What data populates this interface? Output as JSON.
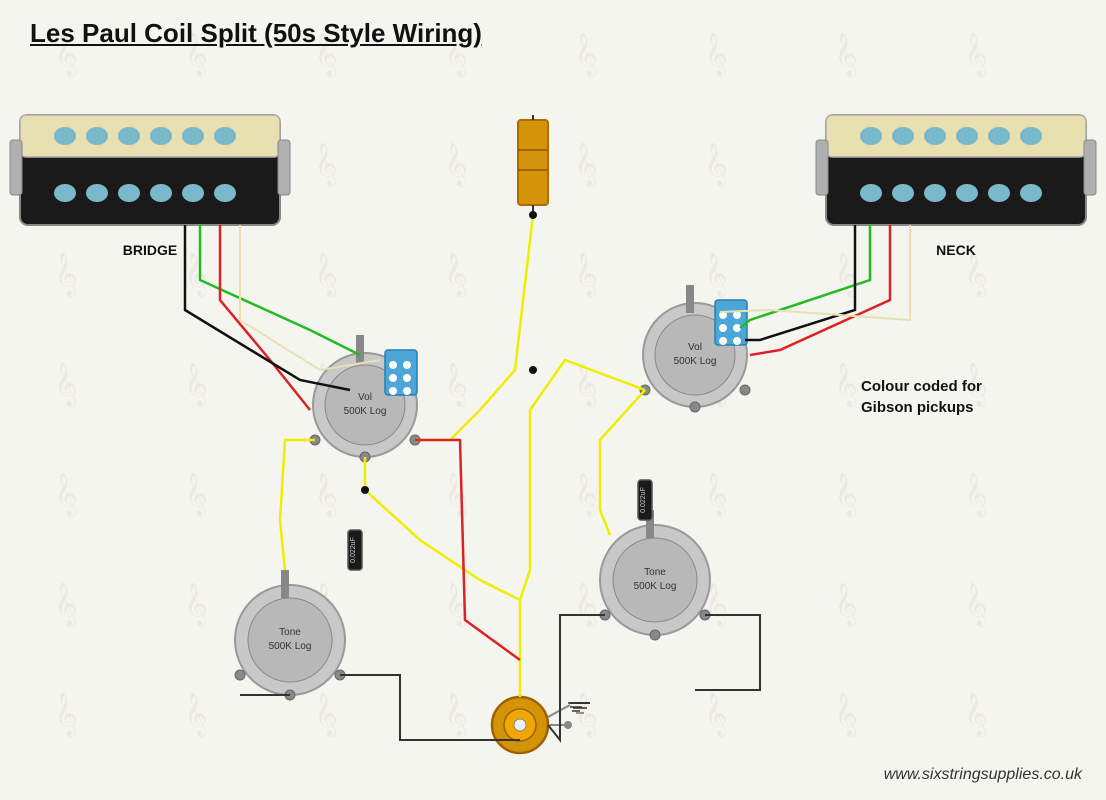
{
  "title": "Les Paul Coil Split (50s Style Wiring)",
  "colour_coded_label": "Colour coded for\nGibson pickups",
  "website": "www.sixstringsupplies.co.uk",
  "bridge_label": "BRIDGE",
  "neck_label": "NECK",
  "vol_bridge_label": "Vol\n500K Log",
  "vol_neck_label": "Vol\n500K Log",
  "tone_bridge_label": "Tone\n500K Log",
  "tone_neck_label": "Tone\n500K Log"
}
